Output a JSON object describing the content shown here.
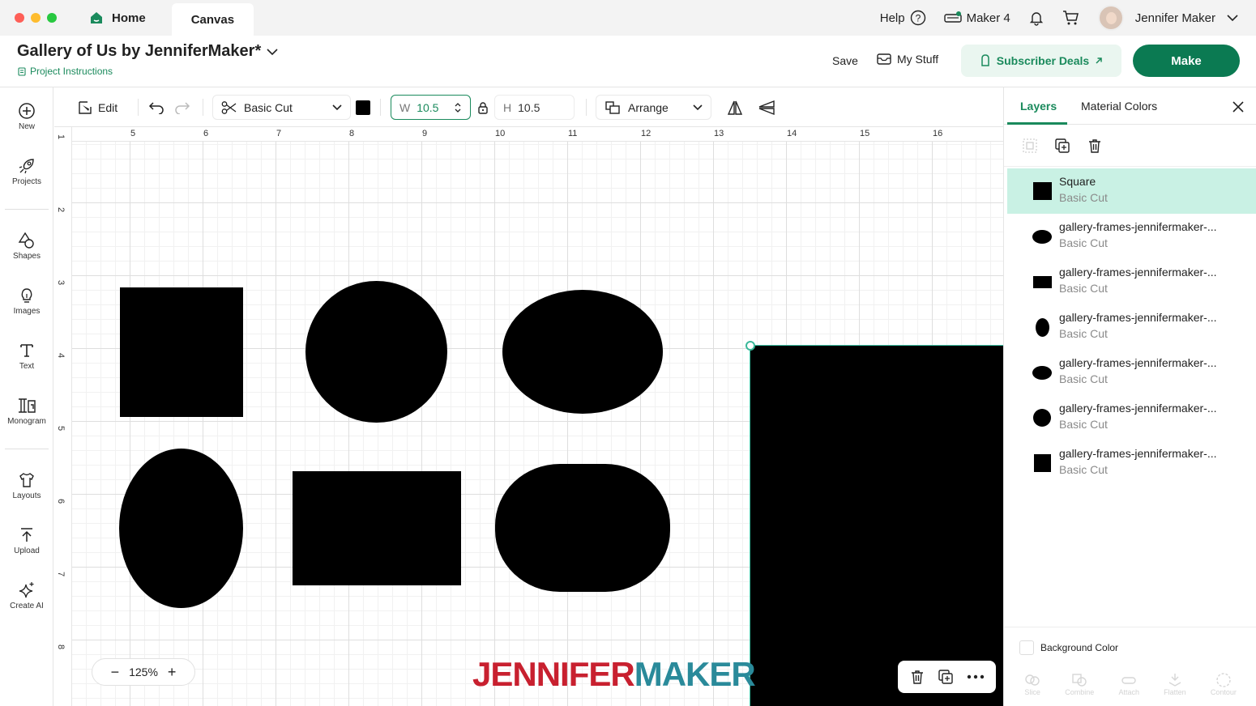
{
  "titlebar": {
    "tabs": [
      {
        "label": "Home"
      },
      {
        "label": "Canvas"
      }
    ],
    "help": "Help",
    "machine": "Maker 4",
    "user": "Jennifer Maker"
  },
  "project": {
    "title": "Gallery of Us by JenniferMaker*",
    "instructions": "Project Instructions",
    "save": "Save",
    "my_stuff": "My Stuff",
    "subscriber_deals": "Subscriber Deals",
    "make": "Make"
  },
  "left_tools": [
    {
      "label": "New",
      "icon": "plus-circle-icon"
    },
    {
      "label": "Projects",
      "icon": "rocket-icon"
    },
    {
      "label": "Shapes",
      "icon": "shapes-icon"
    },
    {
      "label": "Images",
      "icon": "lightbulb-icon"
    },
    {
      "label": "Text",
      "icon": "text-icon"
    },
    {
      "label": "Monogram",
      "icon": "monogram-icon"
    },
    {
      "label": "Layouts",
      "icon": "shirt-icon"
    },
    {
      "label": "Upload",
      "icon": "upload-icon"
    },
    {
      "label": "Create AI",
      "icon": "sparkle-icon"
    }
  ],
  "toolbar": {
    "edit": "Edit",
    "operation": "Basic Cut",
    "color": "#000000",
    "w_label": "W",
    "w_value": "10.5",
    "h_label": "H",
    "h_value": "10.5",
    "arrange": "Arrange"
  },
  "canvas": {
    "ruler_top": [
      "5",
      "6",
      "7",
      "8",
      "9",
      "10",
      "11",
      "12",
      "13",
      "14",
      "15",
      "16"
    ],
    "ruler_left": [
      "1",
      "2",
      "3",
      "4",
      "5",
      "6",
      "7",
      "8"
    ],
    "zoom": "125%",
    "logo_part1": "JENNIFER",
    "logo_part2": "MAKER",
    "logo_color1": "#c8202f",
    "logo_color2": "#2a8a9a",
    "accent": "#1a8a5c"
  },
  "right_panel": {
    "tabs": [
      "Layers",
      "Material Colors"
    ],
    "layers": [
      {
        "name": "Square",
        "sub": "Basic Cut",
        "thumb": "square",
        "selected": true
      },
      {
        "name": "gallery-frames-jennifermaker-...",
        "sub": "Basic Cut",
        "thumb": "ellipse-wide"
      },
      {
        "name": "gallery-frames-jennifermaker-...",
        "sub": "Basic Cut",
        "thumb": "rect-wide"
      },
      {
        "name": "gallery-frames-jennifermaker-...",
        "sub": "Basic Cut",
        "thumb": "ellipse-tall"
      },
      {
        "name": "gallery-frames-jennifermaker-...",
        "sub": "Basic Cut",
        "thumb": "ellipse-wide"
      },
      {
        "name": "gallery-frames-jennifermaker-...",
        "sub": "Basic Cut",
        "thumb": "circle"
      },
      {
        "name": "gallery-frames-jennifermaker-...",
        "sub": "Basic Cut",
        "thumb": "square"
      }
    ],
    "background_color": "Background Color",
    "bottom_tools": [
      "Slice",
      "Combine",
      "Attach",
      "Flatten",
      "Contour"
    ]
  }
}
